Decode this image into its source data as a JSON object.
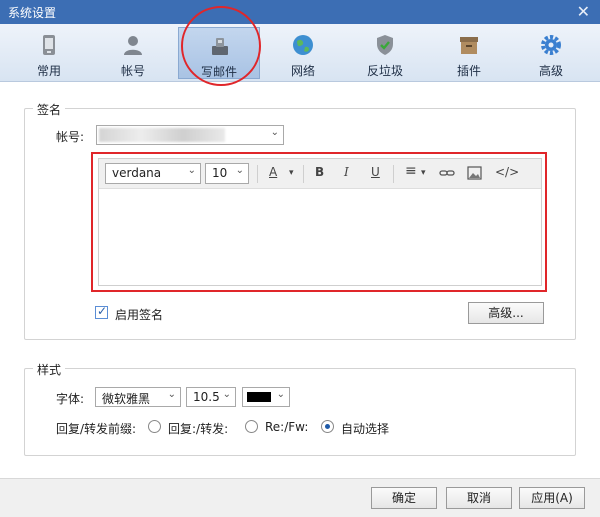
{
  "window": {
    "title": "系统设置",
    "close": "✕"
  },
  "tabs": [
    {
      "label": "常用",
      "icon": "general-icon"
    },
    {
      "label": "帐号",
      "icon": "account-icon"
    },
    {
      "label": "写邮件",
      "icon": "compose-icon",
      "active": true
    },
    {
      "label": "网络",
      "icon": "globe-icon"
    },
    {
      "label": "反垃圾",
      "icon": "shield-icon"
    },
    {
      "label": "插件",
      "icon": "plugin-icon"
    },
    {
      "label": "高级",
      "icon": "gear-icon"
    }
  ],
  "signature": {
    "section_title": "签名",
    "account_label": "帐号:",
    "editor": {
      "font": "verdana",
      "size": "10",
      "font_color_symbol": "A",
      "bold": "B",
      "italic": "I",
      "underline": "U",
      "align_symbol": "≡",
      "code_symbol": "</>"
    },
    "enable_label": "启用签名",
    "advanced_button": "高级..."
  },
  "style": {
    "section_title": "样式",
    "font_label": "字体:",
    "font_value": "微软雅黑",
    "size_value": "10.5",
    "color": "#000000",
    "prefix_label": "回复/转发前缀:",
    "options": [
      "回复:/转发:",
      "Re:/Fw:",
      "自动选择"
    ],
    "selected": "自动选择"
  },
  "footer": {
    "ok": "确定",
    "cancel": "取消",
    "apply": "应用(A)"
  },
  "colors": {
    "titlebar": "#3c6eb4",
    "highlight": "#e0262a"
  }
}
